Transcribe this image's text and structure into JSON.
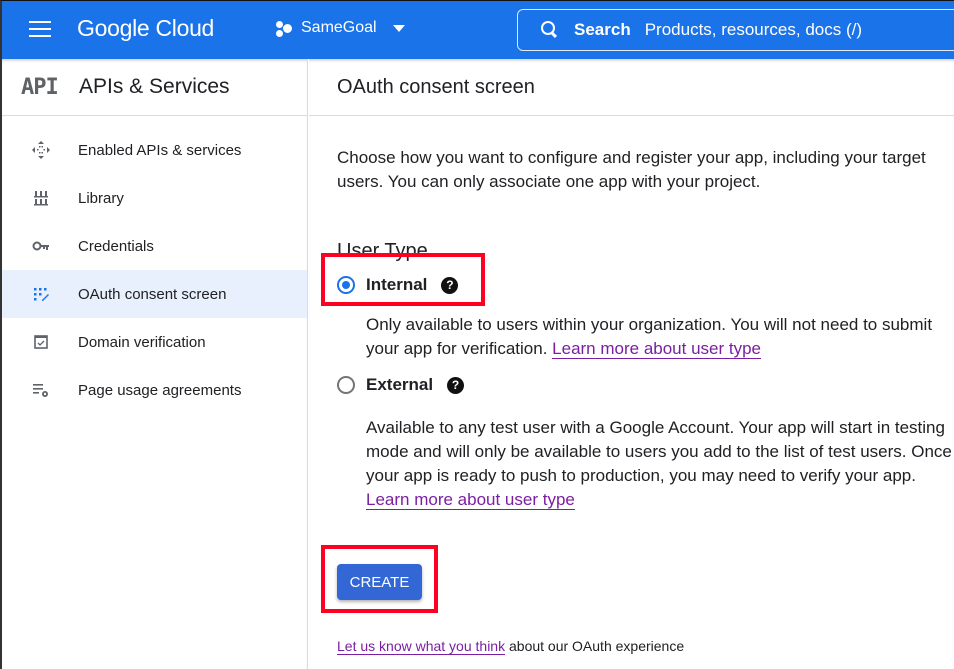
{
  "topbar": {
    "menu_icon": "hamburger-menu-icon",
    "logo": "Google Cloud",
    "project_name": "SameGoal",
    "search_label": "Search",
    "search_placeholder": "Products, resources, docs (/)",
    "brand_color": "#1a73e8"
  },
  "sidebar": {
    "logo_text": "API",
    "title": "APIs & Services",
    "items": [
      {
        "label": "Enabled APIs & services",
        "icon": "enabled-apis-icon",
        "active": false
      },
      {
        "label": "Library",
        "icon": "library-icon",
        "active": false
      },
      {
        "label": "Credentials",
        "icon": "key-icon",
        "active": false
      },
      {
        "label": "OAuth consent screen",
        "icon": "oauth-consent-icon",
        "active": true
      },
      {
        "label": "Domain verification",
        "icon": "domain-verification-icon",
        "active": false
      },
      {
        "label": "Page usage agreements",
        "icon": "page-usage-settings-icon",
        "active": false
      }
    ]
  },
  "main": {
    "title": "OAuth consent screen",
    "intro": "Choose how you want to configure and register your app, including your target users. You can only associate one app with your project.",
    "user_type_title": "User Type",
    "options": [
      {
        "label": "Internal",
        "checked": true,
        "description": "Only available to users within your organization. You will not need to submit your app for verification. ",
        "link": "Learn more about user type"
      },
      {
        "label": "External",
        "checked": false,
        "description": "Available to any test user with a Google Account. Your app will start in testing mode and will only be available to users you add to the list of test users. Once your app is ready to push to production, you may need to verify your app. ",
        "link": "Learn more about user type"
      }
    ],
    "help_glyph": "?",
    "create_label": "CREATE",
    "feedback_link": "Let us know what you think",
    "feedback_text": " about our OAuth experience"
  }
}
